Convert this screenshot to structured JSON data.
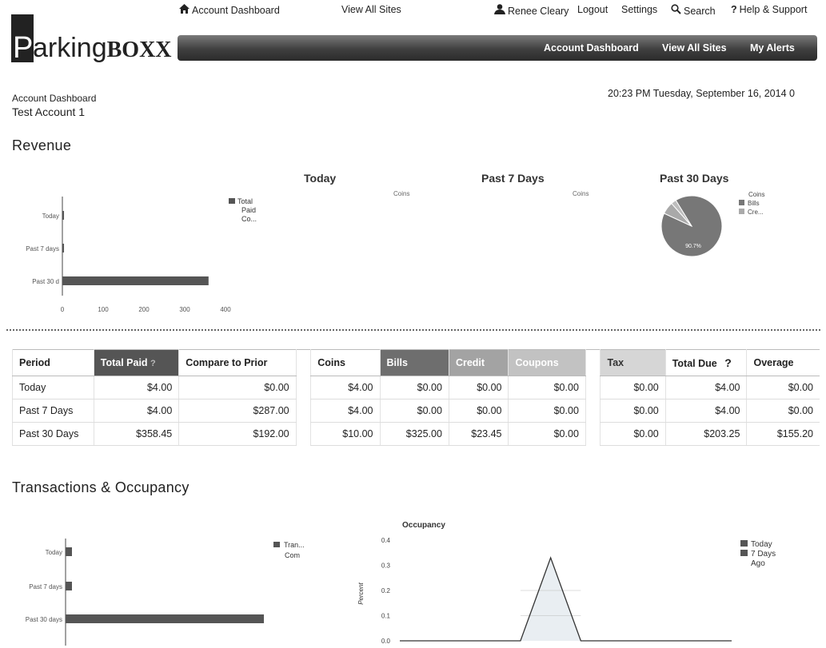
{
  "top_links": {
    "account_dashboard": "Account Dashboard",
    "view_all_sites": "View All Sites",
    "user_name": "Renee Cleary",
    "logout": "Logout",
    "settings": "Settings",
    "search": "Search",
    "help": "Help & Support"
  },
  "logo": {
    "p": "P",
    "arking": "arking",
    "boxx": "BOXX"
  },
  "nav": {
    "account_dashboard": "Account Dashboard",
    "view_all_sites": "View All Sites",
    "my_alerts": "My Alerts"
  },
  "breadcrumb": {
    "page": "Account Dashboard",
    "account": "Test Account 1"
  },
  "datetime": "20:23 PM  Tuesday,  September 16, 2014   0",
  "revenue": {
    "title": "Revenue",
    "col_today": "Today",
    "col_7": "Past 7 Days",
    "col_30": "Past 30 Days",
    "legend_total_paid": [
      "Total",
      "Paid",
      "Co..."
    ],
    "coins_label": "Coins",
    "pie_legend": [
      "Coins",
      "Bills",
      "Cre..."
    ],
    "pie_pct": "90.7%"
  },
  "table": {
    "headers": [
      "Period",
      "Total Paid",
      "Compare to Prior",
      "Coins",
      "Bills",
      "Credit",
      "Coupons",
      "Tax",
      "Total Due",
      "Overage"
    ],
    "rows": [
      [
        "Today",
        "$4.00",
        "$0.00",
        "$4.00",
        "$0.00",
        "$0.00",
        "$0.00",
        "$0.00",
        "$4.00",
        "$0.00"
      ],
      [
        "Past 7 Days",
        "$4.00",
        "$287.00",
        "$4.00",
        "$0.00",
        "$0.00",
        "$0.00",
        "$0.00",
        "$4.00",
        "$0.00"
      ],
      [
        "Past 30 Days",
        "$358.45",
        "$192.00",
        "$10.00",
        "$325.00",
        "$23.45",
        "$0.00",
        "$0.00",
        "$203.25",
        "$155.20"
      ]
    ]
  },
  "transactions": {
    "title": "Transactions & Occupancy",
    "legend": [
      "Tran...",
      "Com"
    ],
    "occupancy_title": "Occupancy",
    "occ_ylabel": "Percent",
    "occ_legend": [
      "Today",
      "7 Days",
      "Ago"
    ]
  },
  "colors": {
    "bar": "#555555",
    "header_dark": "#555555",
    "pie_main": "#777777",
    "pie_light": "#bdbdbd"
  },
  "chart_data": [
    {
      "type": "bar",
      "orientation": "horizontal",
      "categories": [
        "Today",
        "Past 7 days",
        "Past 30 d"
      ],
      "series": [
        {
          "name": "Total Paid",
          "values": [
            4,
            4,
            358.45
          ]
        }
      ],
      "xticks": [
        "0",
        "100",
        "200",
        "300",
        "400"
      ],
      "xlim": [
        0,
        400
      ]
    },
    {
      "type": "pie",
      "labels": [
        "Coins",
        "Bills",
        "Cre..."
      ],
      "values": [
        10,
        325,
        23.45
      ],
      "slice_label": "90.7%"
    },
    {
      "type": "bar",
      "orientation": "horizontal",
      "categories": [
        "Today",
        "Past 7 days",
        "Past 30 days"
      ],
      "values": [
        1,
        1,
        40
      ],
      "xlim": [
        0,
        40
      ]
    },
    {
      "type": "line",
      "title": "Occupancy",
      "ylabel": "Percent",
      "yticks": [
        "0.4",
        "0.3",
        "0.2",
        "0.1",
        "0.0"
      ],
      "ylim": [
        0,
        0.4
      ],
      "series": [
        {
          "name": "Today",
          "values": [
            0,
            0,
            0,
            0,
            0,
            0.33,
            0,
            0,
            0,
            0,
            0,
            0
          ]
        }
      ]
    }
  ]
}
